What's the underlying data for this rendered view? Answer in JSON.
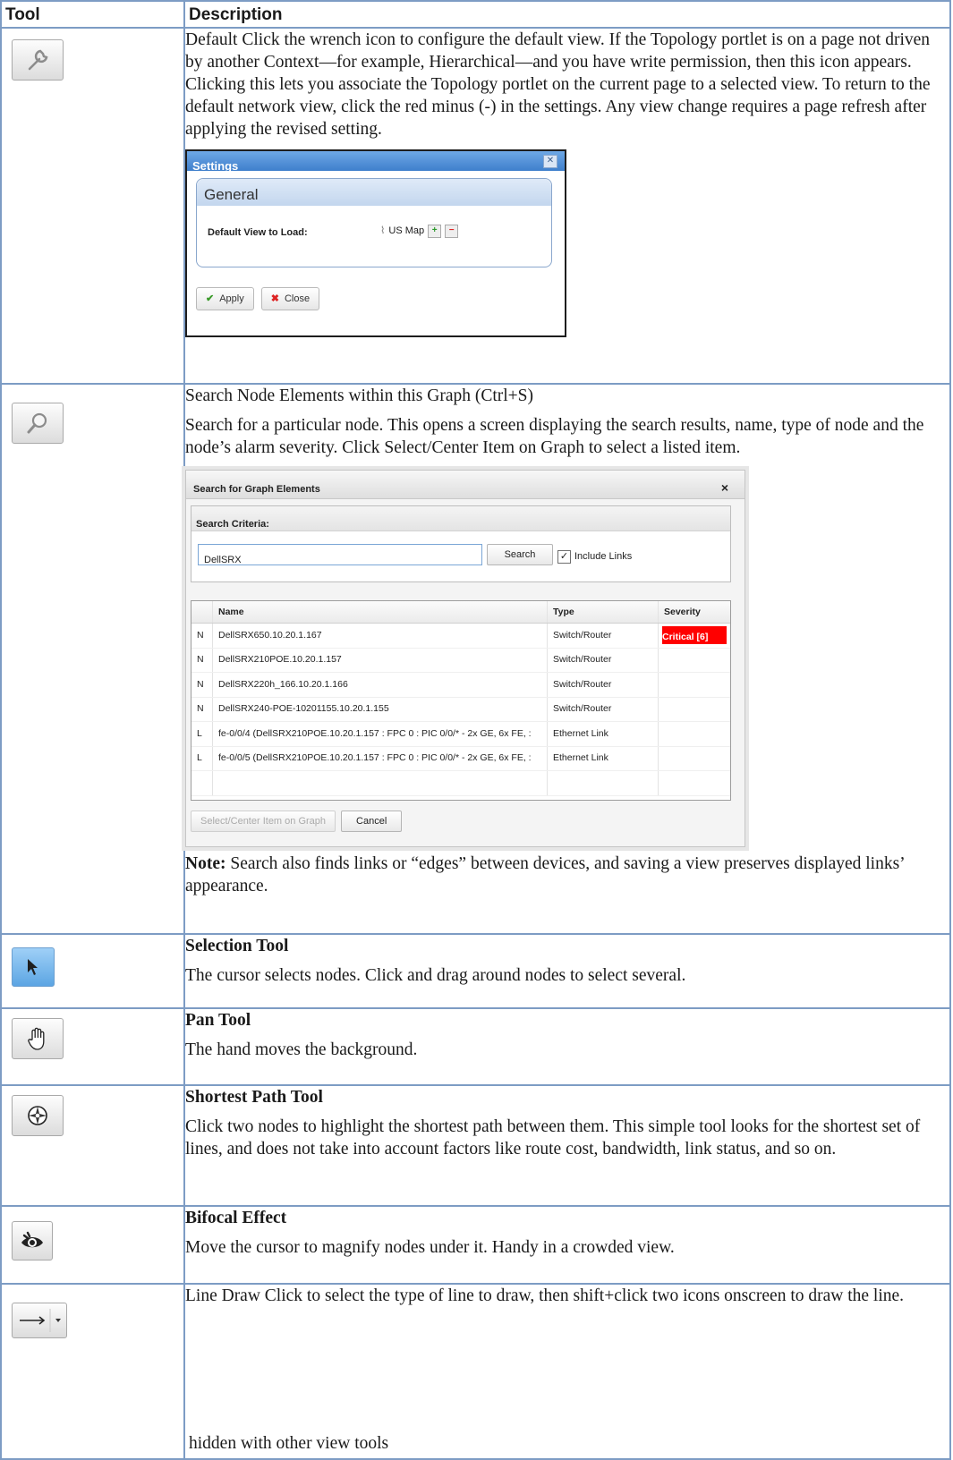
{
  "table": {
    "col_tool": "Tool",
    "col_description": "Description"
  },
  "rows": {
    "default": {
      "icon": "wrench-icon",
      "text": "Default Click the wrench icon to configure the default view. If the Topology portlet is on a page not driven by another Context—for example, Hierarchical—and you have write permission, then this icon appears. Clicking this lets you associate the Topology portlet on the current page to a selected view. To return to the default network view, click the red minus (-) in the settings. Any view change requires a page refresh after applying the revised setting.",
      "settings": {
        "title": "Settings",
        "group": "General",
        "label": "Default View to Load:",
        "value": "US Map",
        "apply": "Apply",
        "close": "Close"
      }
    },
    "search": {
      "icon": "magnifier-icon",
      "heading": "Search Node Elements within this Graph (Ctrl+S)",
      "text": "Search for a particular node. This opens a screen displaying the search results, name, type of node and the node’s alarm severity. Click Select/Center Item on Graph to select a listed item.",
      "dialog": {
        "title": "Search for Graph Elements",
        "criteria": "Search Criteria:",
        "query": "DellSRX",
        "search_btn": "Search",
        "include_links": "Include Links",
        "headers": [
          "Name",
          "Type",
          "Severity"
        ],
        "results": [
          {
            "kind": "N",
            "name": "DellSRX650.10.20.1.167",
            "type": "Switch/Router",
            "severity": "Critical [6]"
          },
          {
            "kind": "N",
            "name": "DellSRX210POE.10.20.1.157",
            "type": "Switch/Router",
            "severity": ""
          },
          {
            "kind": "N",
            "name": "DellSRX220h_166.10.20.1.166",
            "type": "Switch/Router",
            "severity": ""
          },
          {
            "kind": "N",
            "name": "DellSRX240-POE-10201155.10.20.1.155",
            "type": "Switch/Router",
            "severity": ""
          },
          {
            "kind": "L",
            "name": "fe-0/0/4 (DellSRX210POE.10.20.1.157 : FPC 0 : PIC 0/0/* - 2x GE, 6x FE, :",
            "type": "Ethernet Link",
            "severity": ""
          },
          {
            "kind": "L",
            "name": "fe-0/0/5 (DellSRX210POE.10.20.1.157 : FPC 0 : PIC 0/0/* - 2x GE, 6x FE, :",
            "type": "Ethernet Link",
            "severity": ""
          }
        ],
        "select_btn": "Select/Center Item on Graph",
        "cancel_btn": "Cancel"
      },
      "note_label": "Note:",
      "note_text": " Search also finds links or “edges” between devices, and saving a view preserves displayed links’ appearance."
    },
    "selection": {
      "icon": "cursor-arrow-icon",
      "title": "Selection Tool",
      "text": "The cursor selects nodes. Click and drag around nodes to select several."
    },
    "pan": {
      "icon": "hand-icon",
      "title": "Pan Tool",
      "text": "The hand moves the background."
    },
    "shortest": {
      "icon": "compass-icon",
      "title": "Shortest Path Tool",
      "text": "Click two nodes to highlight the shortest path between them. This simple tool looks for the shortest set of lines, and does not take into account factors like route cost, bandwidth, link status, and so on."
    },
    "bifocal": {
      "icon": "eye-icon",
      "title": "Bifocal Effect",
      "text": "Move the cursor to magnify nodes under it. Handy in a crowded view."
    },
    "line": {
      "icon": "arrow-right-dropdown-icon",
      "text": "Line Draw Click to select the type of line to draw, then shift+click two icons onscreen to draw the line.",
      "footer": "hidden with other view tools"
    }
  },
  "colors": {
    "border": "#7d9cc4",
    "critical": "#ff0000",
    "settings_title": "#3f7fcc"
  }
}
